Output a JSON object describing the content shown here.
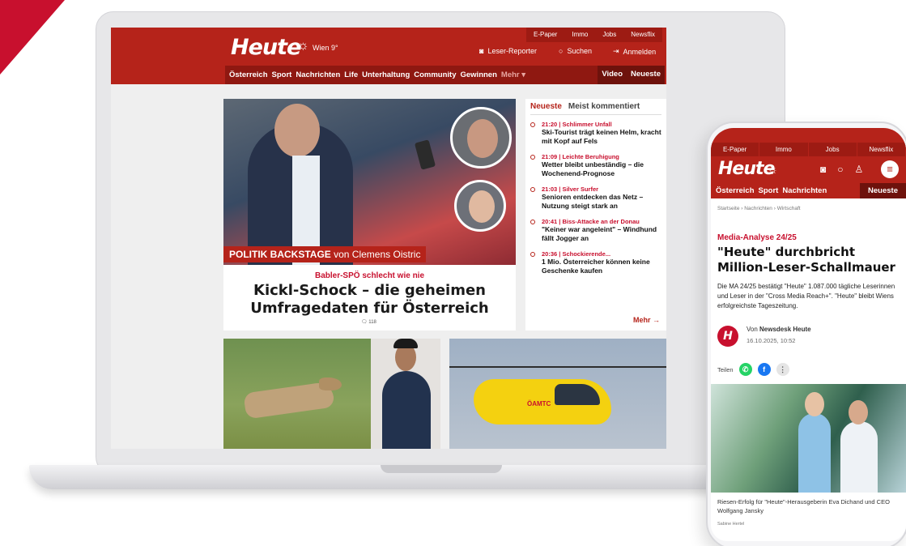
{
  "desktop": {
    "logo": "Heute",
    "weather": "Wien 9°",
    "top_links": [
      "E-Paper",
      "Immo",
      "Jobs",
      "Newsflix"
    ],
    "actions": {
      "reporter": "Leser-Reporter",
      "search": "Suchen",
      "login": "Anmelden"
    },
    "nav": [
      "Österreich",
      "Sport",
      "Nachrichten",
      "Life",
      "Unterhaltung",
      "Community",
      "Gewinnen"
    ],
    "nav_more": "Mehr ▾",
    "nav_right": [
      "Video",
      "Neueste"
    ],
    "hero": {
      "banner_bold": "POLITIK BACKSTAGE",
      "banner_rest": " von Clemens Oistric",
      "kicker": "Babler-SPÖ schlecht wie nie",
      "title": "Kickl-Schock – die geheimen Umfragedaten für Österreich",
      "comments": "118"
    },
    "sidebar": {
      "tab_active": "Neueste",
      "tab_inactive": "Meist kommentiert",
      "items": [
        {
          "meta": "21:20 | Schlimmer Unfall",
          "title": "Ski-Tourist trägt keinen Helm, kracht mit Kopf auf Fels"
        },
        {
          "meta": "21:09 | Leichte Beruhigung",
          "title": "Wetter bleibt unbeständig – die Wochenend-Prognose"
        },
        {
          "meta": "21:03 | Silver Surfer",
          "title": "Senioren entdecken das Netz – Nutzung steigt stark an"
        },
        {
          "meta": "20:41 | Biss-Attacke an der Donau",
          "title": "\"Keiner war angeleint\" – Windhund fällt Jogger an"
        },
        {
          "meta": "20:36 | Schockierende...",
          "title": "1 Mio. Österreicher können keine Geschenke kaufen"
        }
      ],
      "more": "Mehr →"
    },
    "tile_tag": "ÖAMTC"
  },
  "mobile": {
    "top_links": [
      "E-Paper",
      "Immo",
      "Jobs",
      "Newsflix"
    ],
    "logo": "Heute",
    "nav": [
      "Österreich",
      "Sport",
      "Nachrichten"
    ],
    "nav_right": "Neueste",
    "breadcrumb": "Startseite › Nachrichten › Wirtschaft",
    "kicker": "Media-Analyse 24/25",
    "title": "\"Heute\" durchbricht Million-Leser-Schallmauer",
    "lead": "Die MA 24/25 bestätigt \"Heute\" 1.087.000 tägliche Leserinnen und Leser in der \"Cross Media Reach+\". \"Heute\" bleibt Wiens erfolgreichste Tageszeitung.",
    "author_prefix": "Von ",
    "author": "Newsdesk Heute",
    "date": "16.10.2025, 10:52",
    "share_label": "Teilen",
    "caption": "Riesen-Erfolg für \"Heute\"-Herausgeberin Eva Dichand und CEO Wolfgang Jansky",
    "credit": "Sabine Hertel"
  },
  "colors": {
    "brand_red": "#b5231a",
    "dark_red": "#8f1811",
    "accent": "#c8102e"
  }
}
